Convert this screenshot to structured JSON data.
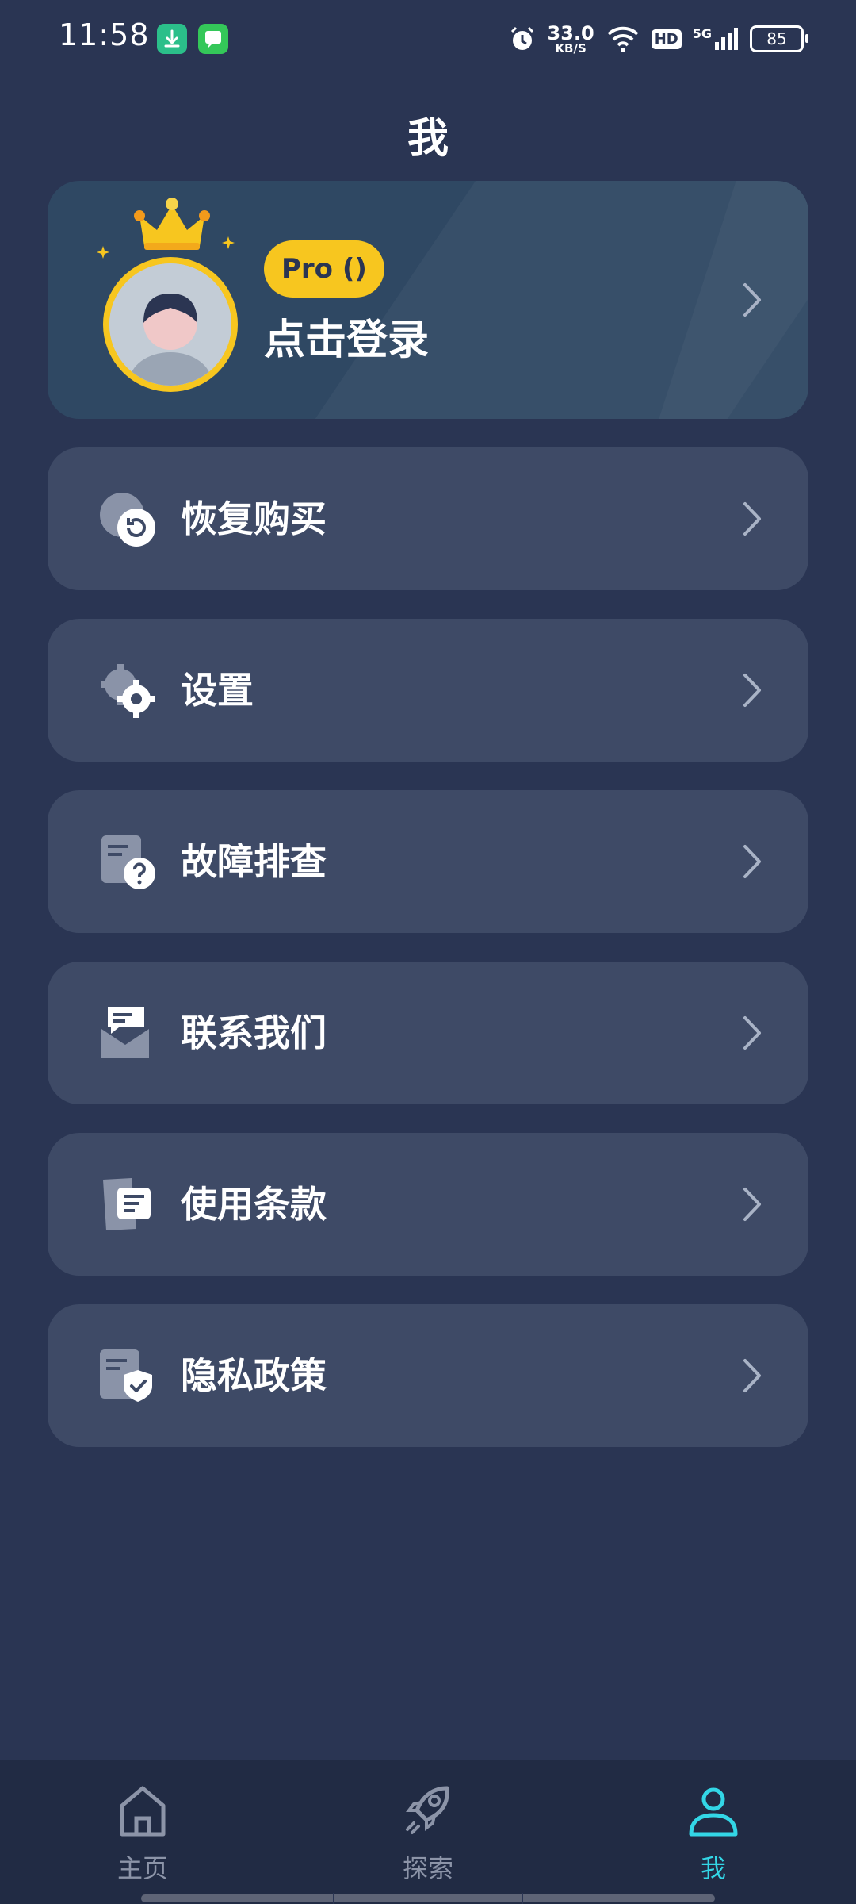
{
  "status_bar": {
    "time": "11:58",
    "net_speed_value": "33.0",
    "net_speed_unit": "KB/S",
    "hd": "HD",
    "signal_label": "5G",
    "battery": "85"
  },
  "header": {
    "title": "我"
  },
  "profile": {
    "badge": "Pro ()",
    "login_prompt": "点击登录"
  },
  "menu": {
    "restore": "恢复购买",
    "settings": "设置",
    "troubleshoot": "故障排查",
    "contact": "联系我们",
    "terms": "使用条款",
    "privacy": "隐私政策"
  },
  "bottom_nav": {
    "home": "主页",
    "explore": "探索",
    "me": "我",
    "active_color": "#33d6e6"
  },
  "colors": {
    "background": "#2a3553",
    "card": "#3e4a66",
    "profile_card": "#2f4863",
    "accent_yellow": "#f7c61f"
  }
}
